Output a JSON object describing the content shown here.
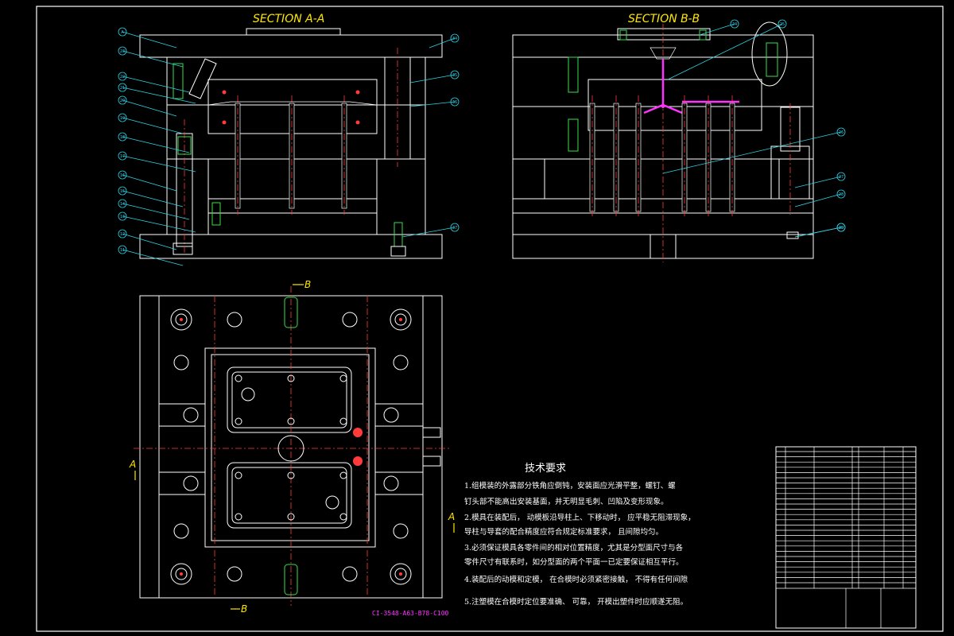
{
  "section_aa_title": "SECTION A-A",
  "section_bb_title": "SECTION B-B",
  "section_mark_a": "A",
  "section_mark_b": "B",
  "requirements": {
    "heading": "技术要求",
    "items": [
      "1.组模装的外露部分铁角应倒钝，安装面应光滑平整，螺钉、螺",
      "  钉头部不能高出安装基面，并无明显毛刺、凹陷及变形现象。",
      "2.模具在装配后，  动模板沿导柱上、下移动时，  应平稳无阻滞现象，",
      "  导柱与导套的配合精度应符合规定标准要求，  且间隙均匀。",
      "3.必须保证模具各零件间的相对位置精度，尤其是分型面尺寸与各",
      "  零件尺寸有联系时，如分型面的两个平面一已定要保证相互平行。",
      "4.装配后的动模和定模，  在合模时必须紧密接触，  不得有任何间隙",
      "5.注塑模在合模时定位要准确、  可靠，  开模出塑件时应顺遂无阻。"
    ]
  },
  "drawing_code": "CI-3548-A63-B78-C100",
  "balloons_left": [
    "A",
    "23",
    "22",
    "21",
    "20",
    "19",
    "18",
    "17",
    "16",
    "15",
    "14",
    "13",
    "12",
    "11",
    "1"
  ],
  "balloons_left_top": [
    "34",
    "35",
    "36",
    "37"
  ],
  "balloons_right": [
    "24",
    "25",
    "26",
    "27",
    "28",
    "29",
    "30"
  ],
  "colors": {
    "background": "#000000",
    "outline": "#ffffff",
    "centerline": "#ff3b3b",
    "leader": "#2ed3e6",
    "title": "#ffe600",
    "runner": "#ff33ff",
    "screw": "#36e04a"
  }
}
